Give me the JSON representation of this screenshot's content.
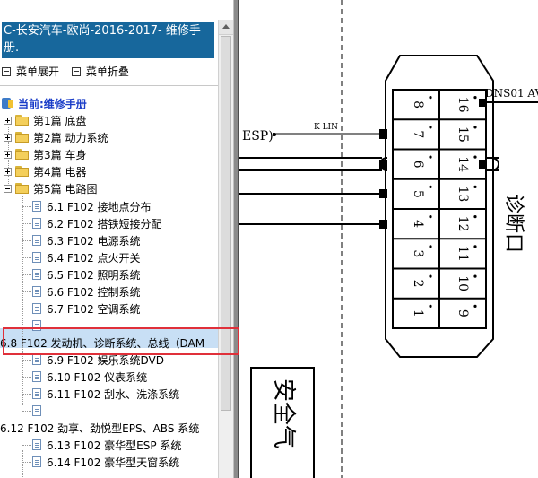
{
  "tree": {
    "title": "C-长安汽车-欧尚-2016-2017- 维修手册.",
    "expand_label": "菜单展开",
    "collapse_label": "菜单折叠",
    "current_label": "当前:维修手册",
    "items": [
      {
        "label": "第1篇 底盘"
      },
      {
        "label": "第2篇 动力系统"
      },
      {
        "label": "第3篇 车身"
      },
      {
        "label": "第4篇 电器"
      },
      {
        "label": "第5篇 电路图"
      },
      {
        "label": "6.1 F102 接地点分布"
      },
      {
        "label": "6.2 F102 搭铁短接分配"
      },
      {
        "label": "6.3 F102 电源系统"
      },
      {
        "label": "6.4 F102 点火开关"
      },
      {
        "label": "6.5 F102 照明系统"
      },
      {
        "label": "6.6 F102 控制系统"
      },
      {
        "label": "6.7 F102 空调系统"
      },
      {
        "label": ""
      },
      {
        "label": "6.8 F102 发动机、诊断系统、总线（DAM"
      },
      {
        "label": "6.9 F102 娱乐系统DVD"
      },
      {
        "label": "6.10 F102 仪表系统"
      },
      {
        "label": "6.11 F102 刮水、洗涤系统"
      },
      {
        "label": ""
      },
      {
        "label": "6.12 F102 劲享、劲悦型EPS、ABS 系统"
      },
      {
        "label": "6.13 F102 豪华型ESP 系统"
      },
      {
        "label": "6.14 F102 豪华型天窗系统"
      }
    ]
  },
  "diagram": {
    "connector_title": "DNS01 AV",
    "kline_label": "K LIN",
    "esp_label": "ESP)",
    "side_label": "诊断口",
    "bottom_label": "安全气",
    "pins_left": [
      "8",
      "7",
      "6",
      "5",
      "4",
      "3",
      "2",
      "1"
    ],
    "pins_right": [
      "16",
      "15",
      "14",
      "13",
      "12",
      "11",
      "10",
      "9"
    ]
  },
  "colors": {
    "title_bg": "#17679c",
    "highlight_bg": "#c8dff5",
    "red_box": "#e0303a",
    "current_label": "#1a3dc8"
  }
}
